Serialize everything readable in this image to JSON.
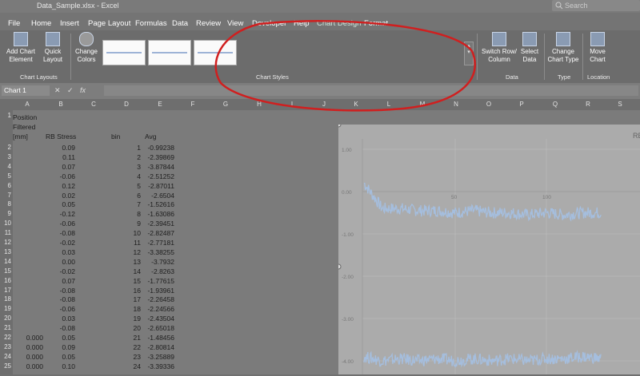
{
  "window": {
    "title": "Data_Sample.xlsx - Excel",
    "search_placeholder": "Search"
  },
  "ribbon_tabs": [
    "File",
    "Home",
    "Insert",
    "Page Layout",
    "Formulas",
    "Data",
    "Review",
    "View",
    "Developer",
    "Help",
    "Chart Design",
    "Format"
  ],
  "active_tab": "Chart Design",
  "ribbon": {
    "add_chart_element": "Add Chart Element",
    "quick_layout": "Quick Layout",
    "change_colors": "Change Colors",
    "switch_row_column": "Switch Row/ Column",
    "select_data": "Select Data",
    "change_chart_type": "Change Chart Type",
    "move_chart": "Move Chart",
    "group_chart_layouts": "Chart Layouts",
    "group_chart_styles": "Chart Styles",
    "group_data": "Data",
    "group_type": "Type",
    "group_location": "Location"
  },
  "formula_bar": {
    "name_box": "Chart 1",
    "fx": "fx"
  },
  "columns": [
    "A",
    "B",
    "C",
    "D",
    "E",
    "F",
    "G",
    "H",
    "I",
    "J",
    "K",
    "L",
    "M",
    "N",
    "O",
    "P",
    "Q",
    "R",
    "S"
  ],
  "headers": {
    "position": "Position",
    "filtered": "Filtered",
    "mm": "[mm]",
    "rb_stress": "RB Stress",
    "bin": "bin",
    "avg": "Avg"
  },
  "rows": [
    {
      "n": "2",
      "a": "",
      "b": "0.09",
      "d": "1",
      "e": "-0.99238"
    },
    {
      "n": "3",
      "a": "",
      "b": "0.11",
      "d": "2",
      "e": "-2.39869"
    },
    {
      "n": "4",
      "a": "",
      "b": "0.07",
      "d": "3",
      "e": "-3.87844"
    },
    {
      "n": "5",
      "a": "",
      "b": "-0.06",
      "d": "4",
      "e": "-2.51252"
    },
    {
      "n": "6",
      "a": "",
      "b": "0.12",
      "d": "5",
      "e": "-2.87011"
    },
    {
      "n": "7",
      "a": "",
      "b": "0.02",
      "d": "6",
      "e": "-2.6504"
    },
    {
      "n": "8",
      "a": "",
      "b": "0.05",
      "d": "7",
      "e": "-1.52616"
    },
    {
      "n": "9",
      "a": "",
      "b": "-0.12",
      "d": "8",
      "e": "-1.63086"
    },
    {
      "n": "10",
      "a": "",
      "b": "-0.06",
      "d": "9",
      "e": "-2.39451"
    },
    {
      "n": "11",
      "a": "",
      "b": "-0.08",
      "d": "10",
      "e": "-2.82487"
    },
    {
      "n": "12",
      "a": "",
      "b": "-0.02",
      "d": "11",
      "e": "-2.77181"
    },
    {
      "n": "13",
      "a": "",
      "b": "0.03",
      "d": "12",
      "e": "-3.38255"
    },
    {
      "n": "14",
      "a": "",
      "b": "0.00",
      "d": "13",
      "e": "-3.7932"
    },
    {
      "n": "15",
      "a": "",
      "b": "-0.02",
      "d": "14",
      "e": "-2.8263"
    },
    {
      "n": "16",
      "a": "",
      "b": "0.07",
      "d": "15",
      "e": "-1.77615"
    },
    {
      "n": "17",
      "a": "",
      "b": "-0.08",
      "d": "16",
      "e": "-1.93961"
    },
    {
      "n": "18",
      "a": "",
      "b": "-0.08",
      "d": "17",
      "e": "-2.26458"
    },
    {
      "n": "19",
      "a": "",
      "b": "-0.06",
      "d": "18",
      "e": "-2.24566"
    },
    {
      "n": "20",
      "a": "",
      "b": "0.03",
      "d": "19",
      "e": "-2.43504"
    },
    {
      "n": "21",
      "a": "",
      "b": "-0.08",
      "d": "20",
      "e": "-2.65018"
    },
    {
      "n": "22",
      "a": "0.000",
      "b": "0.05",
      "d": "21",
      "e": "-1.48456"
    },
    {
      "n": "23",
      "a": "0.000",
      "b": "0.09",
      "d": "22",
      "e": "-2.80814"
    },
    {
      "n": "24",
      "a": "0.000",
      "b": "0.05",
      "d": "23",
      "e": "-3.25889"
    },
    {
      "n": "25",
      "a": "0.000",
      "b": "0.10",
      "d": "24",
      "e": "-3.39336"
    }
  ],
  "chart_data": {
    "type": "line",
    "title": "RB",
    "ylim": [
      -4.2,
      1.2
    ],
    "y_ticks": [
      "1.00",
      "0.00",
      "-1.00",
      "-2.00",
      "-3.00",
      "-4.00"
    ],
    "x_ticks": [
      "50",
      "100"
    ],
    "series": [
      {
        "x": [
          0,
          10,
          20,
          30,
          40,
          50,
          60,
          70,
          80,
          90,
          100,
          110,
          120,
          130
        ],
        "values": [
          0.2,
          -0.4,
          -0.4,
          -0.45,
          -0.45,
          -0.5,
          -0.45,
          -0.5,
          -0.5,
          -0.55,
          -0.5,
          -0.55,
          -0.5,
          -0.5
        ]
      },
      {
        "x": [
          0,
          10,
          20,
          30,
          40,
          50,
          60,
          70,
          80,
          90,
          100,
          110,
          120,
          130
        ],
        "values": [
          -3.9,
          -4.0,
          -3.95,
          -4.0,
          -3.95,
          -4.0,
          -3.95,
          -4.0,
          -3.95,
          -4.0,
          -3.95,
          -3.95,
          -3.9,
          -3.95
        ]
      }
    ],
    "series_color": "#a5bede",
    "grid": true
  },
  "annotation_color": "#d01f1f"
}
